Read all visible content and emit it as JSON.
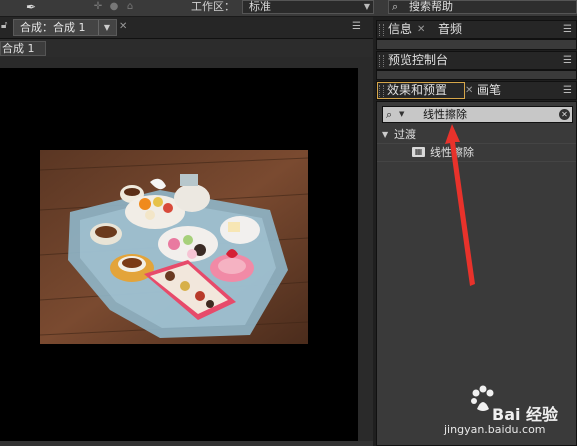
{
  "toolbar": {
    "workspace_label": "工作区：",
    "workspace_value": "标准",
    "help_search_text": "搜索帮助"
  },
  "composition": {
    "tab_label": "合成：合成 1",
    "subtab_label": "合成 1"
  },
  "info_panel": {
    "tabs": [
      "信息",
      "音频"
    ]
  },
  "preview_panel": {
    "tab_label": "预览控制台"
  },
  "effects_panel": {
    "tabs": [
      "效果和预置",
      "画笔"
    ],
    "search_value": "线性擦除",
    "category": "过渡",
    "results": [
      "线性擦除"
    ]
  },
  "watermark": {
    "brand_text": "Bai 经验",
    "url": "jingyan.baidu.com"
  },
  "colors": {
    "annotation_arrow": "#e8322b",
    "active_tab_border": "#d6a64a"
  },
  "icons": {
    "tool": "pen-tool-icon",
    "search": "search-icon",
    "lock": "lock-icon",
    "effect_preset": "effect-preset-icon"
  }
}
